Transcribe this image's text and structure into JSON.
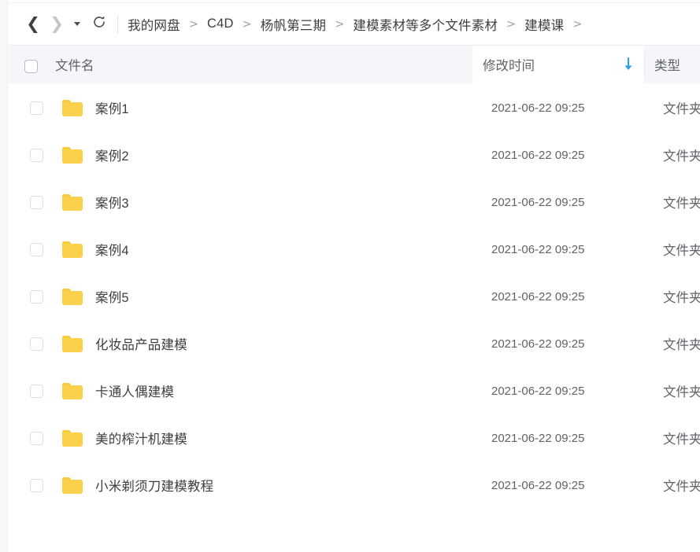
{
  "navbar": {
    "back_icon": "chevron-left-icon",
    "forward_icon": "chevron-right-icon",
    "dropdown_icon": "caret-down-icon",
    "refresh_icon": "refresh-icon",
    "breadcrumb": [
      "我的网盘",
      "C4D",
      "杨帆第三期",
      "建模素材等多个文件素材",
      "建模课"
    ],
    "separator": ">",
    "trailing_separator": ">"
  },
  "columns": {
    "name": "文件名",
    "modified": "修改时间",
    "type": "类型",
    "sort_direction": "descending",
    "sort_icon": "arrow-down-icon",
    "sort_color": "#2ba3e8",
    "select_all_checked": false
  },
  "colors": {
    "folder_yellow": "#fbd14b",
    "folder_tab_yellow": "#f8cc3f",
    "header_bg": "#f5f6fa",
    "accent_blue": "#2ba3e8",
    "text_primary": "#3c4043",
    "text_secondary": "#5f6368"
  },
  "files": [
    {
      "name": "案例1",
      "modified": "2021-06-22 09:25",
      "type": "文件夹",
      "icon": "folder-icon",
      "checked": false
    },
    {
      "name": "案例2",
      "modified": "2021-06-22 09:25",
      "type": "文件夹",
      "icon": "folder-icon",
      "checked": false
    },
    {
      "name": "案例3",
      "modified": "2021-06-22 09:25",
      "type": "文件夹",
      "icon": "folder-icon",
      "checked": false
    },
    {
      "name": "案例4",
      "modified": "2021-06-22 09:25",
      "type": "文件夹",
      "icon": "folder-icon",
      "checked": false
    },
    {
      "name": "案例5",
      "modified": "2021-06-22 09:25",
      "type": "文件夹",
      "icon": "folder-icon",
      "checked": false
    },
    {
      "name": "化妆品产品建模",
      "modified": "2021-06-22 09:25",
      "type": "文件夹",
      "icon": "folder-icon",
      "checked": false
    },
    {
      "name": "卡通人偶建模",
      "modified": "2021-06-22 09:25",
      "type": "文件夹",
      "icon": "folder-icon",
      "checked": false
    },
    {
      "name": "美的榨汁机建模",
      "modified": "2021-06-22 09:25",
      "type": "文件夹",
      "icon": "folder-icon",
      "checked": false
    },
    {
      "name": "小米剃须刀建模教程",
      "modified": "2021-06-22 09:25",
      "type": "文件夹",
      "icon": "folder-icon",
      "checked": false
    }
  ]
}
